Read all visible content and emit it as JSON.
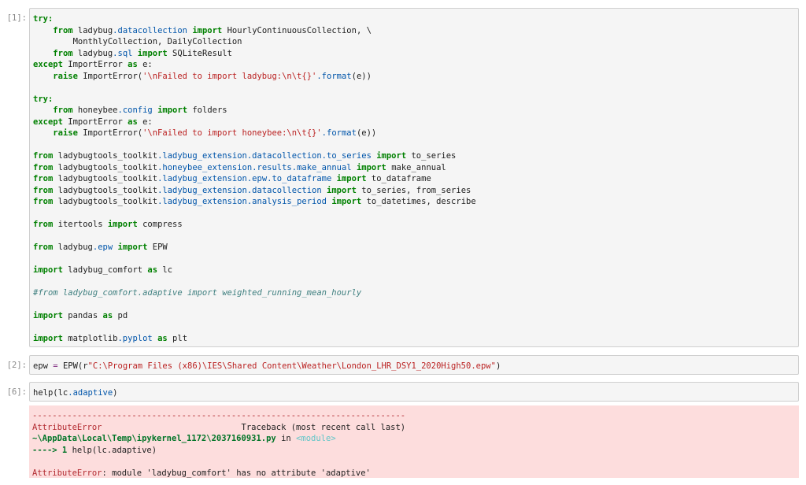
{
  "cells": {
    "c1": {
      "prompt": "[1]:",
      "lines": [
        [
          [
            "kw",
            "try:"
          ]
        ],
        [
          [
            "t",
            "    "
          ],
          [
            "kw",
            "from"
          ],
          [
            "t",
            " ladybug"
          ],
          [
            "mod",
            ".datacollection"
          ],
          [
            "t",
            " "
          ],
          [
            "kw",
            "import"
          ],
          [
            "t",
            " HourlyContinuousCollection, \\"
          ]
        ],
        [
          [
            "t",
            "        MonthlyCollection, DailyCollection"
          ]
        ],
        [
          [
            "t",
            "    "
          ],
          [
            "kw",
            "from"
          ],
          [
            "t",
            " ladybug"
          ],
          [
            "mod",
            ".sql"
          ],
          [
            "t",
            " "
          ],
          [
            "kw",
            "import"
          ],
          [
            "t",
            " SQLiteResult"
          ]
        ],
        [
          [
            "kw",
            "except"
          ],
          [
            "t",
            " ImportError "
          ],
          [
            "kw",
            "as"
          ],
          [
            "t",
            " e:"
          ]
        ],
        [
          [
            "t",
            "    "
          ],
          [
            "kw",
            "raise"
          ],
          [
            "t",
            " ImportError("
          ],
          [
            "str",
            "'\\nFailed to import ladybug:\\n\\t{}'"
          ],
          [
            "mod",
            ".format"
          ],
          [
            "t",
            "(e))"
          ]
        ],
        [],
        [
          [
            "kw",
            "try:"
          ]
        ],
        [
          [
            "t",
            "    "
          ],
          [
            "kw",
            "from"
          ],
          [
            "t",
            " honeybee"
          ],
          [
            "mod",
            ".config"
          ],
          [
            "t",
            " "
          ],
          [
            "kw",
            "import"
          ],
          [
            "t",
            " folders"
          ]
        ],
        [
          [
            "kw",
            "except"
          ],
          [
            "t",
            " ImportError "
          ],
          [
            "kw",
            "as"
          ],
          [
            "t",
            " e:"
          ]
        ],
        [
          [
            "t",
            "    "
          ],
          [
            "kw",
            "raise"
          ],
          [
            "t",
            " ImportError("
          ],
          [
            "str",
            "'\\nFailed to import honeybee:\\n\\t{}'"
          ],
          [
            "mod",
            ".format"
          ],
          [
            "t",
            "(e))"
          ]
        ],
        [],
        [
          [
            "kw",
            "from"
          ],
          [
            "t",
            " ladybugtools_toolkit"
          ],
          [
            "mod",
            ".ladybug_extension.datacollection.to_series"
          ],
          [
            "t",
            " "
          ],
          [
            "kw",
            "import"
          ],
          [
            "t",
            " to_series"
          ]
        ],
        [
          [
            "kw",
            "from"
          ],
          [
            "t",
            " ladybugtools_toolkit"
          ],
          [
            "mod",
            ".honeybee_extension.results.make_annual"
          ],
          [
            "t",
            " "
          ],
          [
            "kw",
            "import"
          ],
          [
            "t",
            " make_annual"
          ]
        ],
        [
          [
            "kw",
            "from"
          ],
          [
            "t",
            " ladybugtools_toolkit"
          ],
          [
            "mod",
            ".ladybug_extension.epw.to_dataframe"
          ],
          [
            "t",
            " "
          ],
          [
            "kw",
            "import"
          ],
          [
            "t",
            " to_dataframe"
          ]
        ],
        [
          [
            "kw",
            "from"
          ],
          [
            "t",
            " ladybugtools_toolkit"
          ],
          [
            "mod",
            ".ladybug_extension.datacollection"
          ],
          [
            "t",
            " "
          ],
          [
            "kw",
            "import"
          ],
          [
            "t",
            " to_series, from_series"
          ]
        ],
        [
          [
            "kw",
            "from"
          ],
          [
            "t",
            " ladybugtools_toolkit"
          ],
          [
            "mod",
            ".ladybug_extension.analysis_period"
          ],
          [
            "t",
            " "
          ],
          [
            "kw",
            "import"
          ],
          [
            "t",
            " to_datetimes, describe"
          ]
        ],
        [],
        [
          [
            "kw",
            "from"
          ],
          [
            "t",
            " itertools "
          ],
          [
            "kw",
            "import"
          ],
          [
            "t",
            " compress"
          ]
        ],
        [],
        [
          [
            "kw",
            "from"
          ],
          [
            "t",
            " ladybug"
          ],
          [
            "mod",
            ".epw"
          ],
          [
            "t",
            " "
          ],
          [
            "kw",
            "import"
          ],
          [
            "t",
            " EPW"
          ]
        ],
        [],
        [
          [
            "kw",
            "import"
          ],
          [
            "t",
            " ladybug_comfort "
          ],
          [
            "kw",
            "as"
          ],
          [
            "t",
            " lc"
          ]
        ],
        [],
        [
          [
            "cm",
            "#from ladybug_comfort.adaptive import weighted_running_mean_hourly"
          ]
        ],
        [],
        [
          [
            "kw",
            "import"
          ],
          [
            "t",
            " pandas "
          ],
          [
            "kw",
            "as"
          ],
          [
            "t",
            " pd"
          ]
        ],
        [],
        [
          [
            "kw",
            "import"
          ],
          [
            "t",
            " matplotlib"
          ],
          [
            "mod",
            ".pyplot"
          ],
          [
            "t",
            " "
          ],
          [
            "kw",
            "as"
          ],
          [
            "t",
            " plt"
          ]
        ]
      ]
    },
    "c2": {
      "prompt": "[2]:",
      "lines": [
        [
          [
            "t",
            "epw "
          ],
          [
            "op",
            "="
          ],
          [
            "t",
            " EPW(r"
          ],
          [
            "str",
            "\"C:\\Program Files (x86)\\IES\\Shared Content\\Weather\\London_LHR_DSY1_2020High50.epw\""
          ],
          [
            "t",
            ")"
          ]
        ]
      ]
    },
    "c3": {
      "prompt": "[6]:",
      "lines": [
        [
          [
            "t",
            "help(lc"
          ],
          [
            "mod",
            ".adaptive"
          ],
          [
            "t",
            ")"
          ]
        ]
      ]
    },
    "output": {
      "lines": [
        [
          [
            "err-red",
            "---------------------------------------------------------------------------"
          ]
        ],
        [
          [
            "err-red",
            "AttributeError"
          ],
          [
            "err-plain",
            "                            Traceback (most recent call last)"
          ]
        ],
        [
          [
            "err-green",
            "~\\AppData\\Local\\Temp\\ipykernel_1172\\2037160931.py"
          ],
          [
            "err-plain",
            " in "
          ],
          [
            "err-cyan",
            "<module>"
          ]
        ],
        [
          [
            "err-green",
            "----> 1"
          ],
          [
            "err-plain",
            " help(lc.adaptive)"
          ]
        ],
        [],
        [
          [
            "err-red",
            "AttributeError"
          ],
          [
            "err-plain",
            ": module 'ladybug_comfort' has no attribute 'adaptive'"
          ]
        ]
      ]
    }
  }
}
